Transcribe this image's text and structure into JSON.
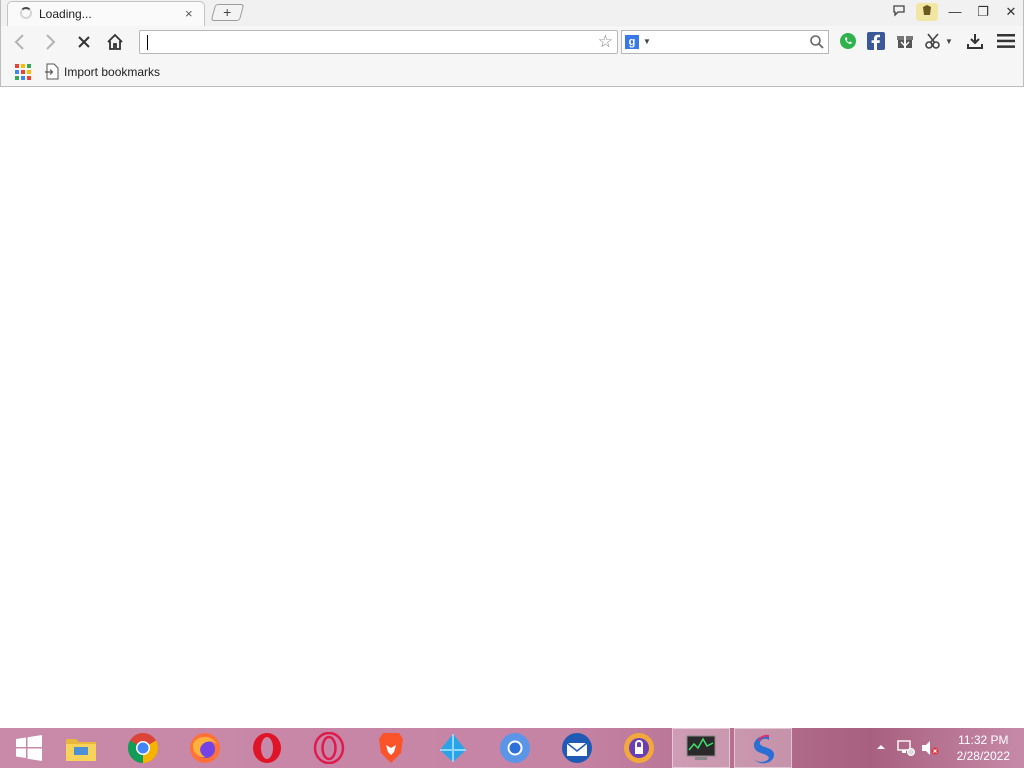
{
  "tab": {
    "title": "Loading...",
    "close": "×"
  },
  "new_tab": {
    "label": "+"
  },
  "window": {
    "minimize": "—",
    "restore": "❐",
    "close": "✕"
  },
  "toolbar": {
    "address_value": "",
    "search_engine_letter": "g",
    "search_value": ""
  },
  "extensions": [
    "whatsapp-icon",
    "facebook-icon",
    "gift-icon",
    "scissors-icon",
    "download-icon",
    "menu-icon"
  ],
  "bookmarks": {
    "label": "Import bookmarks"
  },
  "colors": {
    "apps": [
      "#ea4335",
      "#fbbc05",
      "#34a853",
      "#4285f4",
      "#ea4335",
      "#fbbc05",
      "#34a853",
      "#4285f4",
      "#ea4335"
    ],
    "taskbar": "#c684a5"
  },
  "taskbar": {
    "apps": [
      "start-icon",
      "file-explorer-icon",
      "chrome-icon",
      "firefox-icon",
      "opera-icon",
      "opera-gx-icon",
      "brave-icon",
      "kite-icon",
      "chromium-icon",
      "thunderbird-icon",
      "vpn-lock-icon",
      "task-manager-icon",
      "browser-active-icon"
    ]
  },
  "clock": {
    "time": "11:32 PM",
    "date": "2/28/2022"
  }
}
